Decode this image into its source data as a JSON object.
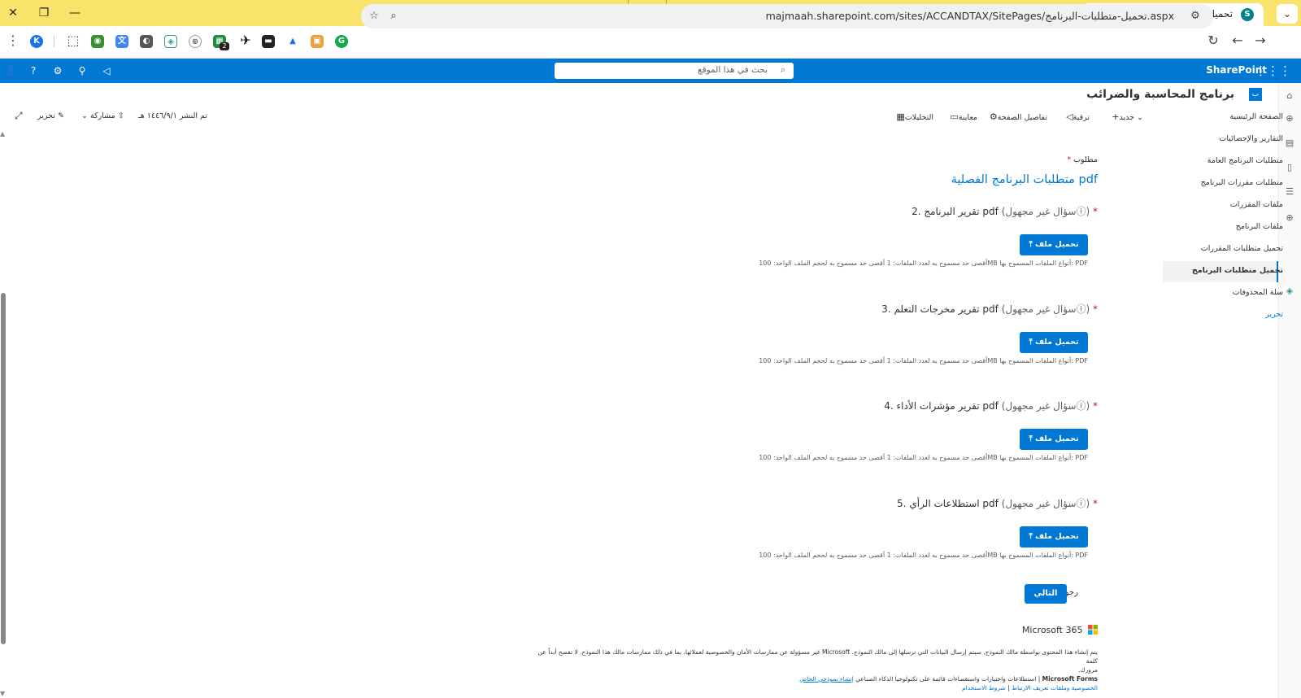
{
  "browser": {
    "tab_title": "تحميل متطلبات البرنامج",
    "tab_favicon_letter": "S",
    "url": "majmaah.sharepoint.com/sites/ACCANDTAX/SitePages/تحميل-متطلبات-البرنامج.aspx",
    "profile_letter": "K",
    "extension_badge": "2"
  },
  "suite": {
    "brand": "SharePoint",
    "search_placeholder": "بحث في هذا الموقع"
  },
  "site": {
    "title": "برنامج المحاسبة والضرائب",
    "logo_letter": "ب"
  },
  "nav": {
    "items": [
      "الصفحة الرئيسية",
      "التقارير والإحصائيات",
      "متطلبات البرنامج العامة",
      "متطلبات مقررات البرنامج",
      "ملفات المقررات",
      "ملفات البرنامج",
      "تحميل متطلبات المقررات",
      "تحميل متطلبات البرنامج",
      "سلة المحذوفات"
    ],
    "edit_label": "تحرير"
  },
  "command_bar": {
    "new": "جديد",
    "promote": "ترقية",
    "page_details": "تفاصيل الصفحة",
    "preview": "معاينة",
    "analytics": "التحليلات",
    "published": "تم النشر ١٤٤٦/٩/١ هـ",
    "share": "مشاركة",
    "edit": "تحرير"
  },
  "form": {
    "required_note": "مطلوب",
    "section_title": "متطلبات البرنامج الفصلية pdf",
    "anon_label": "(سؤال غير مجهول",
    "upload_label": "تحميل ملف",
    "limits_note": "أقصى حد مسموح به لعدد الملفات: 1  أقصى حد مسموح به لحجم الملف الواحد: 100MB  أنواع الملفات المسموح بها: PDF",
    "questions": [
      {
        "number": "2.",
        "title": "تقرير البرنامج pdf"
      },
      {
        "number": "3.",
        "title": "تقرير مخرجات التعلم pdf"
      },
      {
        "number": "4.",
        "title": "تقرير مؤشرات الأداء pdf"
      },
      {
        "number": "5.",
        "title": "استطلاعات الرأي pdf"
      }
    ],
    "back_label": "رجوع",
    "next_label": "التالي",
    "ms365": "Microsoft 365",
    "disclaimer_1": "يتم إنشاء هذا المحتوى بواسطة مالك النموذج. سيتم إرسال البيانات التي ترسلها إلى مالك النموذج. Microsoft غير مسؤولة عن ممارسات الأمان والخصوصية لعملائها، بما في ذلك ممارسات مالك هذا النموذج. لا تفصح أبداً عن كلمة",
    "disclaimer_2": "مرورك.",
    "disclaimer_3_bold": "Microsoft Forms",
    "disclaimer_3": " | استطلاعات واختبارات واستقصاءات قائمة على تكنولوجيا الذكاء الصناعي",
    "disclaimer_link": "إنشاء نموذجي الخاص",
    "privacy_link": "الخصوصية وملفات تعريف الارتباط",
    "terms_link": "شروط الاستخدام"
  }
}
